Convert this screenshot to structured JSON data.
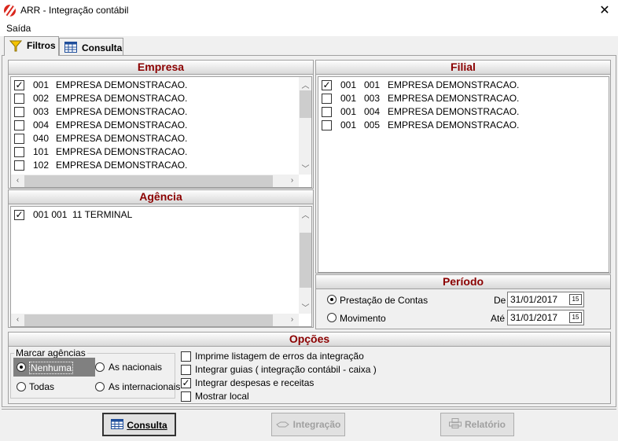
{
  "window": {
    "app": "ARR",
    "title": "ARR -  Integração contábil",
    "close": "✕"
  },
  "menu": {
    "saida": "Saída"
  },
  "tabs": [
    {
      "label": "Filtros"
    },
    {
      "label": "Consulta"
    }
  ],
  "empresa": {
    "header": "Empresa",
    "items": [
      {
        "code": "001",
        "name": "EMPRESA DEMONSTRACAO.",
        "checked": true
      },
      {
        "code": "002",
        "name": "EMPRESA DEMONSTRACAO.",
        "checked": false
      },
      {
        "code": "003",
        "name": "EMPRESA DEMONSTRACAO.",
        "checked": false
      },
      {
        "code": "004",
        "name": "EMPRESA DEMONSTRACAO.",
        "checked": false
      },
      {
        "code": "040",
        "name": "EMPRESA DEMONSTRACAO.",
        "checked": false
      },
      {
        "code": "101",
        "name": "EMPRESA DEMONSTRACAO.",
        "checked": false
      },
      {
        "code": "102",
        "name": "EMPRESA DEMONSTRACAO.",
        "checked": false
      }
    ]
  },
  "agencia": {
    "header": "Agência",
    "items": [
      {
        "code": "001 001",
        "name": "11 TERMINAL",
        "checked": true
      }
    ]
  },
  "filial": {
    "header": "Filial",
    "items": [
      {
        "emp": "001",
        "code": "001",
        "name": "EMPRESA DEMONSTRACAO.",
        "checked": true
      },
      {
        "emp": "001",
        "code": "003",
        "name": "EMPRESA DEMONSTRACAO.",
        "checked": false
      },
      {
        "emp": "001",
        "code": "004",
        "name": "EMPRESA DEMONSTRACAO.",
        "checked": false
      },
      {
        "emp": "001",
        "code": "005",
        "name": "EMPRESA DEMONSTRACAO.",
        "checked": false
      }
    ]
  },
  "periodo": {
    "header": "Período",
    "option1": "Prestação de Contas",
    "option2": "Movimento",
    "selected": "Prestação de Contas",
    "de_label": "De",
    "de_value": "31/01/2017",
    "ate_label": "Até",
    "ate_value": "31/01/2017",
    "cal_glyph": "15"
  },
  "opcoes": {
    "header": "Opções",
    "marcar_label": "Marcar agências",
    "radios": {
      "nenhuma": "Nenhuma",
      "todas": "Todas",
      "nacionais": "As nacionais",
      "internacionais": "As internacionais"
    },
    "selected_radio": "Nenhuma",
    "checks": [
      {
        "label": "Imprime listagem de erros da integração",
        "checked": false
      },
      {
        "label": "Integrar guias ( integração contábil - caixa )",
        "checked": false
      },
      {
        "label": "Integrar despesas e receitas",
        "checked": true
      },
      {
        "label": "Mostrar local",
        "checked": false
      }
    ]
  },
  "buttons": {
    "consulta": "Consulta",
    "integracao": "Integração",
    "relatorio": "Relatório"
  },
  "colors": {
    "header_text": "#8b0000",
    "selected_bg": "#808080"
  }
}
